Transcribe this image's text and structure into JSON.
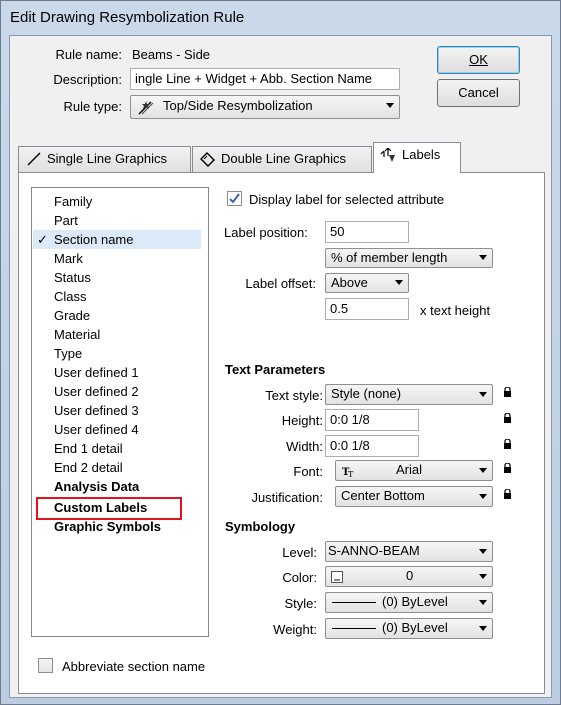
{
  "window": {
    "title": "Edit Drawing Resymbolization Rule"
  },
  "header": {
    "rule_name_label": "Rule name:",
    "rule_name_value": "Beams - Side",
    "description_label": "Description:",
    "description_value": "ingle Line + Widget + Abb. Section Name",
    "rule_type_label": "Rule type:",
    "rule_type_value": "Top/Side Resymbolization"
  },
  "buttons": {
    "ok": "OK",
    "cancel": "Cancel"
  },
  "tabs": [
    {
      "label": "Single Line Graphics"
    },
    {
      "label": "Double Line Graphics"
    },
    {
      "label": "Labels"
    }
  ],
  "attributes": {
    "items": [
      {
        "label": "Family"
      },
      {
        "label": "Part"
      },
      {
        "label": "Section name",
        "check": "✓"
      },
      {
        "label": "Mark"
      },
      {
        "label": "Status"
      },
      {
        "label": "Class"
      },
      {
        "label": "Grade"
      },
      {
        "label": "Material"
      },
      {
        "label": "Type"
      },
      {
        "label": "User defined 1"
      },
      {
        "label": "User defined 2"
      },
      {
        "label": "User defined 3"
      },
      {
        "label": "User defined 4"
      },
      {
        "label": "End 1 detail"
      },
      {
        "label": "End 2 detail"
      },
      {
        "label": "Analysis Data"
      },
      {
        "label": "Custom Labels"
      },
      {
        "label": "Graphic Symbols"
      }
    ],
    "selected_label": "Section name"
  },
  "label_settings": {
    "display_label": "Display label for selected attribute",
    "display_checked": true,
    "position_label": "Label position:",
    "position_value": "50",
    "position_unit": "% of member length",
    "offset_label": "Label offset:",
    "offset_value": "Above",
    "offset_amount": "0.5",
    "offset_unit": "x text height"
  },
  "text_parameters": {
    "title": "Text Parameters",
    "style_label": "Text style:",
    "style_value": "Style (none)",
    "height_label": "Height:",
    "height_value": "0:0 1/8",
    "width_label": "Width:",
    "width_value": "0:0 1/8",
    "font_label": "Font:",
    "font_value": "Arial",
    "justification_label": "Justification:",
    "justification_value": "Center Bottom"
  },
  "symbology": {
    "title": "Symbology",
    "level_label": "Level:",
    "level_value": "S-ANNO-BEAM",
    "color_label": "Color:",
    "color_value": "0",
    "style_label": "Style:",
    "style_value": "(0) ByLevel",
    "weight_label": "Weight:",
    "weight_value": "(0) ByLevel"
  },
  "footer": {
    "abbreviate_label": "Abbreviate section name",
    "abbreviate_checked": false
  },
  "colors": {
    "highlight_box": "#e1141e",
    "selection": "#dbeaf9",
    "title_bar": "#c9d7e6"
  }
}
